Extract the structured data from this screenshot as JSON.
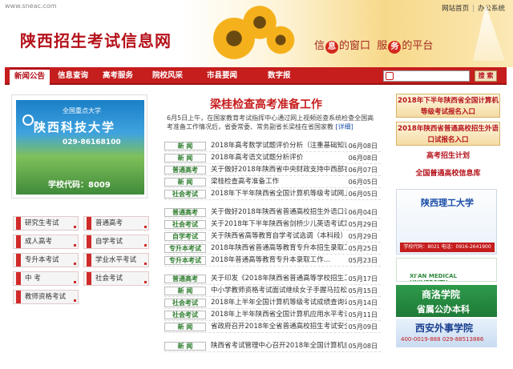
{
  "header": {
    "site_url": "www.sneac.com",
    "top_links": [
      "网站首页",
      "办公系统"
    ],
    "title": "陕西招生考试信息网",
    "slogan_part1": "信",
    "slogan_mark1": "息",
    "slogan_part2": "的窗口",
    "slogan_part3": "服",
    "slogan_mark2": "务",
    "slogan_part4": "的平台"
  },
  "nav": {
    "tabs": [
      "新闻公告",
      "信息查询",
      "高考服务",
      "院校风采",
      "市县要闻",
      "数字报"
    ],
    "active_tab": "新闻公告",
    "search_button": "搜 索"
  },
  "left": {
    "university": {
      "caption": "全国重点大学",
      "name": "陕西科技大学",
      "phone": "029-86168100",
      "code": "学校代码：8009"
    },
    "quick_links": [
      "研究生考试",
      "普通高考",
      "成人高考",
      "自学考试",
      "专升本考试",
      "学业水平考试",
      "中 考",
      "社会考试",
      "教师资格考试"
    ]
  },
  "center": {
    "headline": "梁桂检查高考准备工作",
    "summary": "6月5日上午，在国家教育考试指挥中心与全国高考考务工作视频会议后，省委常委、常务副省长梁桂在省教育厅考试院检查全国高考准备工作进展情况。省教育厅…",
    "summary_shown": "6月5日上午，在国家教育考试指挥中心通过网上视频巡查系统检查全国高考准备工作情况后，省委常委、常务副省长梁桂在省国家教",
    "more": "[详细]",
    "group1": [
      {
        "cat": "新 闻",
        "title": "2018年高考数学试题评价分析（注重基础知识…",
        "date": "06月08日"
      },
      {
        "cat": "新 闻",
        "title": "2018年高考语文试题分析评价",
        "date": "06月08日"
      },
      {
        "cat": "普通高考",
        "title": "关于做好2018年陕西省中央财政支持中西部农…",
        "date": "06月07日"
      },
      {
        "cat": "新 闻",
        "title": "梁桂检查高考准备工作",
        "date": "06月05日"
      },
      {
        "cat": "社会考试",
        "title": "2018年下半年陕西省全国计算机等级考试网上…",
        "date": "06月05日"
      }
    ],
    "group2": [
      {
        "cat": "普通高考",
        "title": "关于做好2018年陕西省普通高校招生外语口试…",
        "date": "06月04日"
      },
      {
        "cat": "社会考试",
        "title": "关于2018年下半年陕西省剑桥少儿英语考试定…",
        "date": "05月29日"
      },
      {
        "cat": "自学考试",
        "title": "关于陕西省高等教育自学考试选调（本科段）…",
        "date": "05月29日"
      },
      {
        "cat": "专升本考试",
        "title": "2018年陕西省普通高等教育专升本招生录取工…",
        "date": "05月25日"
      },
      {
        "cat": "专升本考试",
        "title": "2018年普通高等教育专升本录取工作…",
        "date": "05月23日"
      }
    ],
    "group3": [
      {
        "cat": "普通高考",
        "title": "关于印发《2018年陕西省普通高等学校招生工…",
        "date": "05月17日"
      },
      {
        "cat": "新 闻",
        "title": "中小学教师资格考试面试继续女子手握马拉松…",
        "date": "05月15日"
      },
      {
        "cat": "社会考试",
        "title": "2018年上半年全国计算机等级考试成绩查询公告",
        "date": "05月14日"
      },
      {
        "cat": "社会考试",
        "title": "2018年上半年陕西省全国计算机应用水平考试…",
        "date": "05月11日"
      },
      {
        "cat": "新 闻",
        "title": "省政府召开2018年全省普通高校招生考试安全…",
        "date": "05月09日"
      }
    ],
    "group4": [
      {
        "cat": "新 闻",
        "title": "陕西省考试管理中心召开2018年全国计算机应…",
        "date": "05月08日"
      }
    ]
  },
  "right": {
    "btn1": "2018年下半年陕西省全国计算机等级考试报名入口",
    "btn2": "2018年陕西省普通高校招生外语口试报名入口",
    "link1": "高考招生计划",
    "link2": "全国普通高校信息库",
    "ads": [
      {
        "name": "陕西理工大学",
        "line": "学校代码：8021  电话：0916-2641900"
      },
      {
        "name": "XI'AN MEDICAL UNIVERSITY"
      },
      {
        "name": "商洛学院",
        "line": "省属公办本科"
      },
      {
        "name": "西安外事学院",
        "line": "400-0019-888 029-88513886"
      }
    ]
  }
}
